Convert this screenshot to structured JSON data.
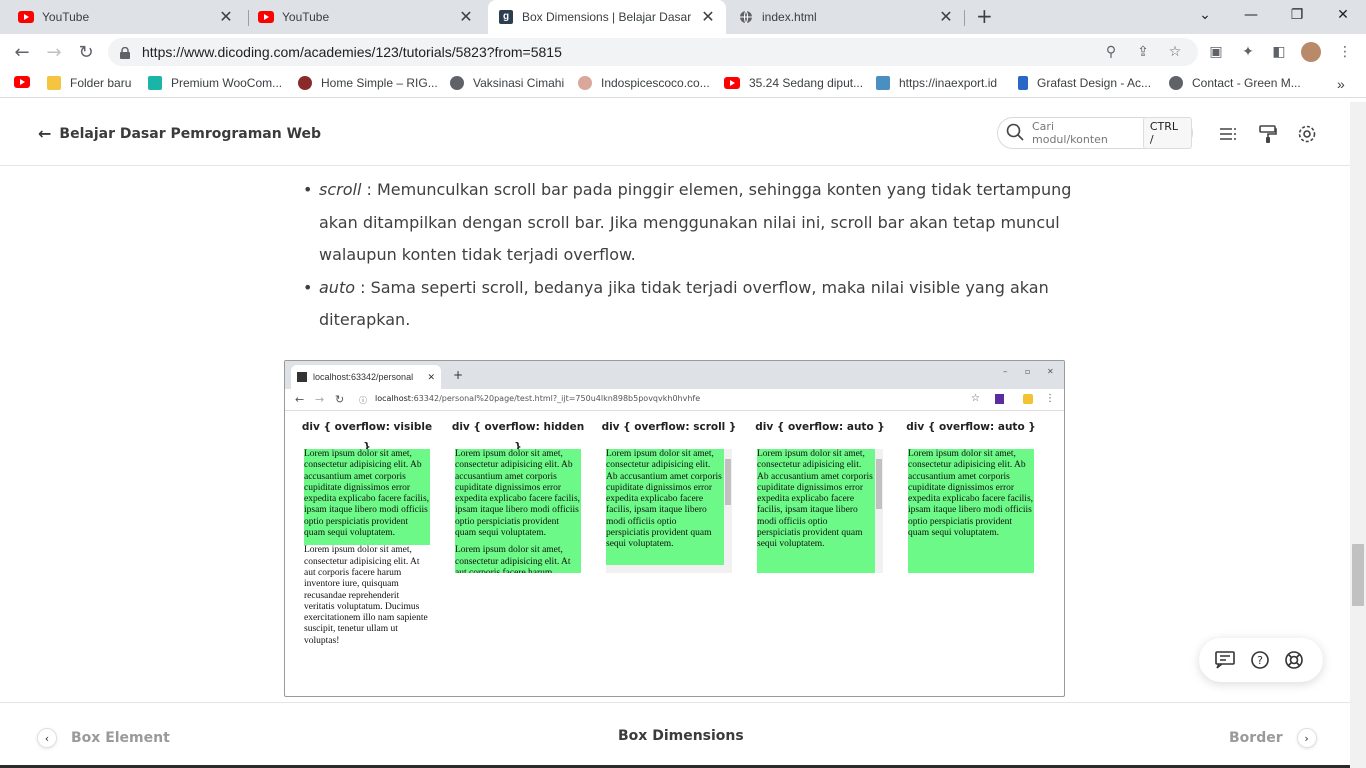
{
  "browser": {
    "tabs": [
      {
        "title": "YouTube",
        "icon": "youtube-icon"
      },
      {
        "title": "YouTube",
        "icon": "youtube-icon"
      },
      {
        "title": "Box Dimensions | Belajar Dasar Pe",
        "icon": "dicoding-icon"
      },
      {
        "title": "index.html",
        "icon": "globe-icon"
      }
    ],
    "url": "https://www.dicoding.com/academies/123/tutorials/5823?from=5815",
    "bookmarks": [
      "Folder baru",
      "Premium WooCom...",
      "Home Simple – RIG...",
      "Vaksinasi Cimahi",
      "Indospicescoco.co...",
      "35.24 Sedang diput...",
      "https://inaexport.id",
      "Grafast Design - Ac...",
      "Contact - Green M..."
    ]
  },
  "header": {
    "title": "Belajar Dasar Pemrograman Web",
    "search_placeholder": "Cari modul/konten",
    "search_shortcut": "CTRL  /"
  },
  "article": {
    "items": [
      {
        "term": "scroll",
        "text": " : Memunculkan scroll bar pada pinggir elemen, sehingga konten yang tidak tertampung akan ditampilkan dengan scroll bar. Jika menggunakan nilai ini, scroll bar akan tetap muncul walaupun konten tidak terjadi overflow."
      },
      {
        "term": "auto",
        "text": " : Sama seperti scroll, bedanya jika tidak terjadi overflow, maka nilai visible yang akan diterapkan."
      }
    ]
  },
  "figure": {
    "tab_title": "localhost:63342/personal",
    "url_host": "localhost",
    "url_rest": ":63342/personal%20page/test.html?_ijt=750u4lkn898b5povqvkh0hvhfe",
    "columns": [
      {
        "title": "div { overflow: visible }"
      },
      {
        "title": "div { overflow: hidden }"
      },
      {
        "title": "div { overflow: scroll }"
      },
      {
        "title": "div { overflow: auto }"
      },
      {
        "title": "div { overflow: auto }"
      }
    ],
    "para1": "Lorem ipsum dolor sit amet, consectetur adipisicing elit. Ab accusantium amet corporis cupiditate dignissimos error expedita explicabo facere facilis, ipsam itaque libero modi officiis optio perspiciatis provident quam sequi voluptatem.",
    "para2": "Lorem ipsum dolor sit amet, consectetur adipisicing elit. At aut corporis facere harum inventore iure, quisquam recusandae reprehenderit veritatis voluptatum. Ducimus exercitationem illo nam sapiente suscipit, tenetur ullam ut voluptas!"
  },
  "bottom_nav": {
    "prev": "Box Element",
    "current": "Box Dimensions",
    "next": "Border"
  }
}
